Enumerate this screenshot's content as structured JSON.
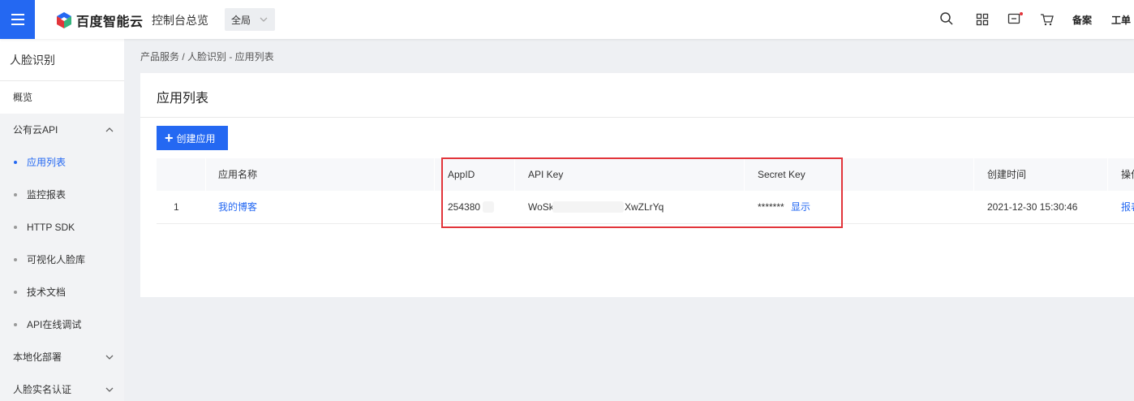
{
  "topbar": {
    "logo_text": "百度智能云",
    "console_label": "控制台总览",
    "region_value": "全局",
    "beian_label": "备案",
    "workorder_label": "工单",
    "icons": [
      "search-icon",
      "grid-icon",
      "message-icon",
      "cart-icon"
    ],
    "accent": "#2468f2",
    "notify_color": "#e2353b"
  },
  "sidebar": {
    "title": "人脸识别",
    "overview": "概览",
    "public_api": "公有云API",
    "sub_items": [
      {
        "label": "应用列表",
        "active": true
      },
      {
        "label": "监控报表",
        "active": false
      },
      {
        "label": "HTTP SDK",
        "active": false
      },
      {
        "label": "可视化人脸库",
        "active": false
      },
      {
        "label": "技术文档",
        "active": false
      },
      {
        "label": "API在线调试",
        "active": false
      }
    ],
    "local_deploy": "本地化部署",
    "realname": "人脸实名认证"
  },
  "breadcrumb": "产品服务 / 人脸识别 - 应用列表",
  "main": {
    "title": "应用列表",
    "create_button": "创建应用"
  },
  "table": {
    "headers": {
      "name": "应用名称",
      "appid": "AppID",
      "apikey": "API Key",
      "secret": "Secret Key",
      "created": "创建时间",
      "action": "操作"
    },
    "rows": [
      {
        "index": "1",
        "name": "我的博客",
        "appid_visible": "254380",
        "apikey_prefix": "WoSk",
        "apikey_suffix": "XwZLrYq",
        "secret_mask": "*******",
        "secret_show": "显示",
        "created": "2021-12-30 15:30:46",
        "action": "报表"
      }
    ]
  },
  "highlight_color": "#e2353b"
}
